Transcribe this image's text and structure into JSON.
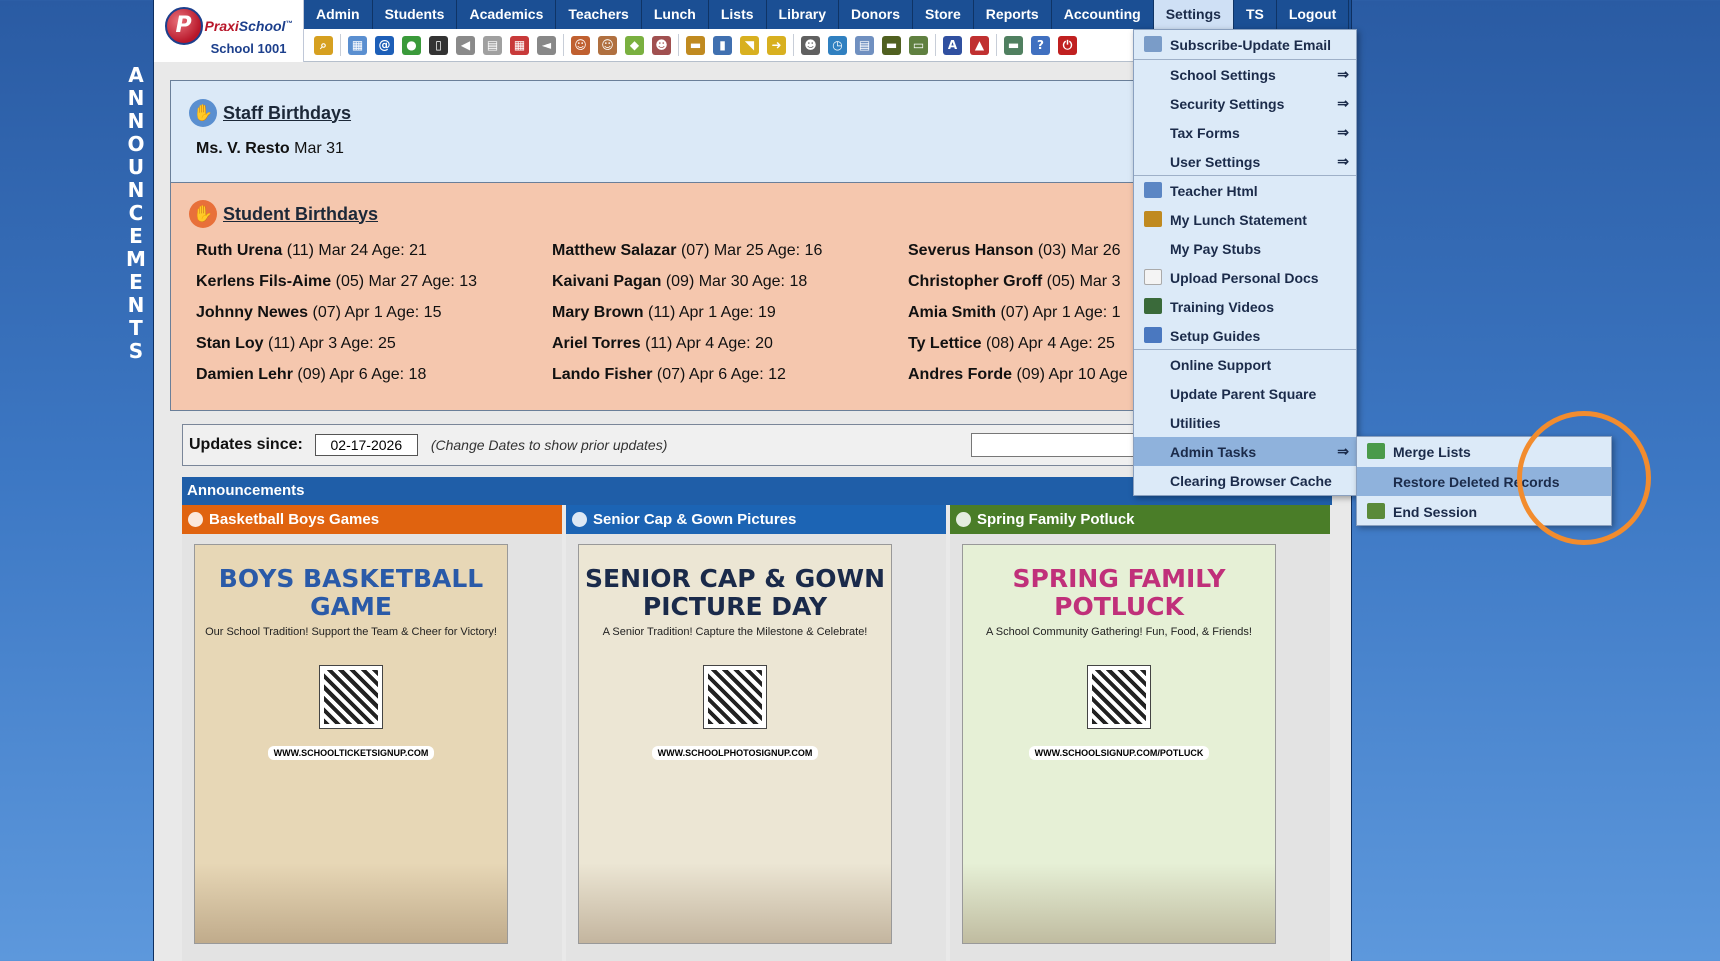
{
  "announcements_vertical": [
    "A",
    "N",
    "N",
    "O",
    "U",
    "N",
    "C",
    "E",
    "M",
    "E",
    "N",
    "T",
    "S"
  ],
  "logo": {
    "brand_a": "Praxi",
    "brand_b": "School",
    "mark": "P",
    "tm": "™",
    "school": "School 1001"
  },
  "nav": [
    "Admin",
    "Students",
    "Academics",
    "Teachers",
    "Lunch",
    "Lists",
    "Library",
    "Donors",
    "Store",
    "Reports",
    "Accounting",
    "Settings",
    "TS",
    "Logout"
  ],
  "toolbar_icons": [
    {
      "name": "search-icon",
      "color": "#d6a020",
      "glyph": "⌕"
    },
    {
      "name": "calendar-grid-icon",
      "color": "#5a8fd0",
      "glyph": "▦"
    },
    {
      "name": "email-at-icon",
      "color": "#1d5fb8",
      "glyph": "@"
    },
    {
      "name": "chat-icon",
      "color": "#3a9a3a",
      "glyph": "●"
    },
    {
      "name": "phone-icon",
      "color": "#333333",
      "glyph": "▯"
    },
    {
      "name": "speaker-icon",
      "color": "#8a8a8a",
      "glyph": "◀"
    },
    {
      "name": "news-icon",
      "color": "#a0a0a0",
      "glyph": "▤"
    },
    {
      "name": "calendar-icon",
      "color": "#c83a3a",
      "glyph": "▦"
    },
    {
      "name": "megaphone-icon",
      "color": "#888888",
      "glyph": "◄"
    },
    {
      "name": "teacher-icon",
      "color": "#c06030",
      "glyph": "☺"
    },
    {
      "name": "student-icon",
      "color": "#b07040",
      "glyph": "☺"
    },
    {
      "name": "eraser-icon",
      "color": "#7ab040",
      "glyph": "◆"
    },
    {
      "name": "group-icon",
      "color": "#a05050",
      "glyph": "☻"
    },
    {
      "name": "lunch-icon",
      "color": "#c08a20",
      "glyph": "▬"
    },
    {
      "name": "book-icon",
      "color": "#4070b0",
      "glyph": "▮"
    },
    {
      "name": "tag-icon",
      "color": "#d8b020",
      "glyph": "◥"
    },
    {
      "name": "export-icon",
      "color": "#d8b020",
      "glyph": "➜"
    },
    {
      "name": "person-icon",
      "color": "#606060",
      "glyph": "☻"
    },
    {
      "name": "clock-icon",
      "color": "#3080c0",
      "glyph": "◷"
    },
    {
      "name": "list-icon",
      "color": "#7090c0",
      "glyph": "▤"
    },
    {
      "name": "ruler-icon",
      "color": "#506020",
      "glyph": "▬"
    },
    {
      "name": "printer-icon",
      "color": "#608040",
      "glyph": "▭"
    },
    {
      "name": "ap-icon",
      "color": "#3050a0",
      "glyph": "A"
    },
    {
      "name": "pdf-icon",
      "color": "#c03030",
      "glyph": "▲"
    },
    {
      "name": "money-icon",
      "color": "#508060",
      "glyph": "▬"
    },
    {
      "name": "help-icon",
      "color": "#4070c0",
      "glyph": "?"
    },
    {
      "name": "power-icon",
      "color": "#c02020",
      "glyph": "⏻"
    }
  ],
  "staff": {
    "title": "Staff Birthdays",
    "name": "Ms. V. Resto",
    "date": "Mar 31"
  },
  "students": {
    "title": "Student Birthdays",
    "rows": [
      {
        "name": "Ruth Urena",
        "detail": "(11) Mar 24 Age: 21"
      },
      {
        "name": "Matthew Salazar",
        "detail": "(07) Mar 25 Age: 16"
      },
      {
        "name": "Severus Hanson",
        "detail": "(03) Mar 26"
      },
      {
        "name": "Kerlens Fils-Aime",
        "detail": "(05) Mar 27 Age: 13"
      },
      {
        "name": "Kaivani Pagan",
        "detail": "(09) Mar 30 Age: 18"
      },
      {
        "name": "Christopher Groff",
        "detail": "(05) Mar 3"
      },
      {
        "name": "Johnny Newes",
        "detail": "(07) Apr 1 Age: 15"
      },
      {
        "name": "Mary Brown",
        "detail": "(11) Apr 1 Age: 19"
      },
      {
        "name": "Amia Smith",
        "detail": "(07) Apr 1 Age: 1"
      },
      {
        "name": "Stan Loy",
        "detail": "(11) Apr 3 Age: 25"
      },
      {
        "name": "Ariel Torres",
        "detail": "(11) Apr 4 Age: 20"
      },
      {
        "name": "Ty Lettice",
        "detail": "(08) Apr 4 Age: 25"
      },
      {
        "name": "Damien Lehr",
        "detail": "(09) Apr 6 Age: 18"
      },
      {
        "name": "Lando Fisher",
        "detail": "(07) Apr 6 Age: 12"
      },
      {
        "name": "Andres Forde",
        "detail": "(09) Apr 10 Age"
      }
    ]
  },
  "updates": {
    "label": "Updates since:",
    "date": "02-17-2026",
    "hint": "(Change Dates to show prior updates)"
  },
  "announcements": {
    "header": "Announcements",
    "items": [
      {
        "title": "Basketball Boys Games",
        "color": "#e0630f",
        "poster_title": "BOYS BASKETBALL GAME",
        "poster_sub": "Our School Tradition! Support the Team & Cheer for Victory!",
        "poster_url": "WWW.SCHOOLTICKETSIGNUP.COM",
        "poster_bg": "#e7d7b6",
        "title_color": "#2a5aa8"
      },
      {
        "title": "Senior Cap & Gown Pictures",
        "color": "#1c64b4",
        "poster_title": "SENIOR CAP & GOWN PICTURE DAY",
        "poster_sub": "A Senior Tradition! Capture the Milestone & Celebrate!",
        "poster_url": "WWW.SCHOOLPHOTOSIGNUP.COM",
        "poster_bg": "#ece6d4",
        "title_color": "#1a2a4a"
      },
      {
        "title": "Spring Family Potluck",
        "color": "#4a7d28",
        "poster_title": "SPRING FAMILY POTLUCK",
        "poster_sub": "A School Community Gathering! Fun, Food, & Friends!",
        "poster_url": "WWW.SCHOOLSIGNUP.COM/POTLUCK",
        "poster_bg": "#e6f0d6",
        "title_color": "#c0307a"
      }
    ]
  },
  "settings_menu": [
    {
      "label": "Subscribe-Update Email",
      "icon": "email-icon",
      "icon_color": "#7a9cc8",
      "arrow": ""
    },
    {
      "label": "School Settings",
      "icon": "",
      "icon_color": "",
      "arrow": "⇒"
    },
    {
      "label": "Security Settings",
      "icon": "",
      "icon_color": "",
      "arrow": "⇒"
    },
    {
      "label": "Tax Forms",
      "icon": "",
      "icon_color": "",
      "arrow": "⇒"
    },
    {
      "label": "User Settings",
      "icon": "",
      "icon_color": "",
      "arrow": "⇒"
    },
    {
      "label": "Teacher Html",
      "icon": "html-icon",
      "icon_color": "#5b86c4",
      "arrow": ""
    },
    {
      "label": "My Lunch Statement",
      "icon": "lunch-icon",
      "icon_color": "#c08a20",
      "arrow": ""
    },
    {
      "label": "My Pay Stubs",
      "icon": "",
      "icon_color": "",
      "arrow": ""
    },
    {
      "label": "Upload Personal Docs",
      "icon": "document-icon",
      "icon_color": "#f4f4f4",
      "arrow": ""
    },
    {
      "label": "Training Videos",
      "icon": "film-icon",
      "icon_color": "#3a6a3a",
      "arrow": ""
    },
    {
      "label": "Setup Guides",
      "icon": "help-icon",
      "icon_color": "#4a78c0",
      "arrow": ""
    },
    {
      "label": "Online Support",
      "icon": "",
      "icon_color": "",
      "arrow": ""
    },
    {
      "label": "Update Parent Square",
      "icon": "",
      "icon_color": "",
      "arrow": ""
    },
    {
      "label": "Utilities",
      "icon": "",
      "icon_color": "",
      "arrow": ""
    },
    {
      "label": "Admin Tasks",
      "icon": "",
      "icon_color": "",
      "arrow": "⇒"
    },
    {
      "label": "Clearing Browser Cache",
      "icon": "",
      "icon_color": "",
      "arrow": ""
    }
  ],
  "admin_submenu": [
    {
      "label": "Merge Lists",
      "icon": "merge-icon",
      "icon_color": "#4a9a4a"
    },
    {
      "label": "Restore Deleted Records",
      "icon": "",
      "icon_color": ""
    },
    {
      "label": "End Session",
      "icon": "exit-icon",
      "icon_color": "#5a8a3a"
    }
  ]
}
